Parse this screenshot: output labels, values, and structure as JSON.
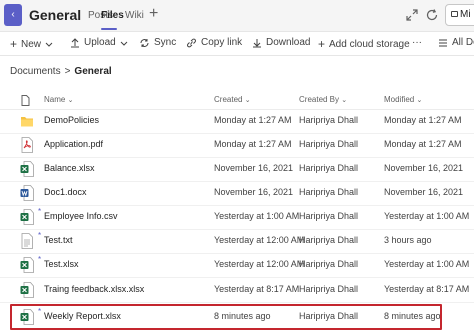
{
  "header": {
    "channel": "General",
    "tabs": [
      {
        "label": "Posts"
      },
      {
        "label": "Files"
      },
      {
        "label": "Wiki"
      }
    ],
    "meet_label": "Mi"
  },
  "toolbar": {
    "new": "New",
    "upload": "Upload",
    "sync": "Sync",
    "copy_link": "Copy link",
    "download": "Download",
    "add_cloud": "Add cloud storage",
    "more": "···",
    "all_docs": "All Doc"
  },
  "breadcrumb": {
    "root": "Documents",
    "separator": ">",
    "current": "General"
  },
  "table": {
    "columns": {
      "name": "Name",
      "created": "Created",
      "created_by": "Created By",
      "modified": "Modified"
    },
    "rows": [
      {
        "icon": "folder-icon",
        "name": "DemoPolicies",
        "created": "Monday at 1:27 AM",
        "created_by": "Haripriya Dhall",
        "modified": "Monday at 1:27 AM",
        "new": false
      },
      {
        "icon": "pdf-icon",
        "name": "Application.pdf",
        "created": "Monday at 1:27 AM",
        "created_by": "Haripriya Dhall",
        "modified": "Monday at 1:27 AM",
        "new": false
      },
      {
        "icon": "excel-icon",
        "name": "Balance.xlsx",
        "created": "November 16, 2021",
        "created_by": "Haripriya Dhall",
        "modified": "November 16, 2021",
        "new": false
      },
      {
        "icon": "word-icon",
        "name": "Doc1.docx",
        "created": "November 16, 2021",
        "created_by": "Haripriya Dhall",
        "modified": "November 16, 2021",
        "new": false
      },
      {
        "icon": "excel-icon",
        "name": "Employee Info.csv",
        "created": "Yesterday at 1:00 AM",
        "created_by": "Haripriya Dhall",
        "modified": "Yesterday at 1:00 AM",
        "new": true
      },
      {
        "icon": "text-file-icon",
        "name": "Test.txt",
        "created": "Yesterday at 12:00 AM",
        "created_by": "Haripriya Dhall",
        "modified": "3 hours ago",
        "new": true
      },
      {
        "icon": "excel-icon",
        "name": "Test.xlsx",
        "created": "Yesterday at 12:00 AM",
        "created_by": "Haripriya Dhall",
        "modified": "Yesterday at 1:00 AM",
        "new": true
      },
      {
        "icon": "excel-icon",
        "name": "Traing feedback.xlsx.xlsx",
        "created": "Yesterday at 8:17 AM",
        "created_by": "Haripriya Dhall",
        "modified": "Yesterday at 8:17 AM",
        "new": false
      },
      {
        "icon": "excel-icon",
        "name": "Weekly Report.xlsx",
        "created": "8 minutes ago",
        "created_by": "Haripriya Dhall",
        "modified": "8 minutes ago",
        "new": true
      }
    ]
  },
  "colors": {
    "accent": "#5b5fc7",
    "highlight": "#c4262e",
    "excel": "#1d7044",
    "word": "#2b579a",
    "pdf": "#d13438",
    "folder": "#f5c242"
  }
}
